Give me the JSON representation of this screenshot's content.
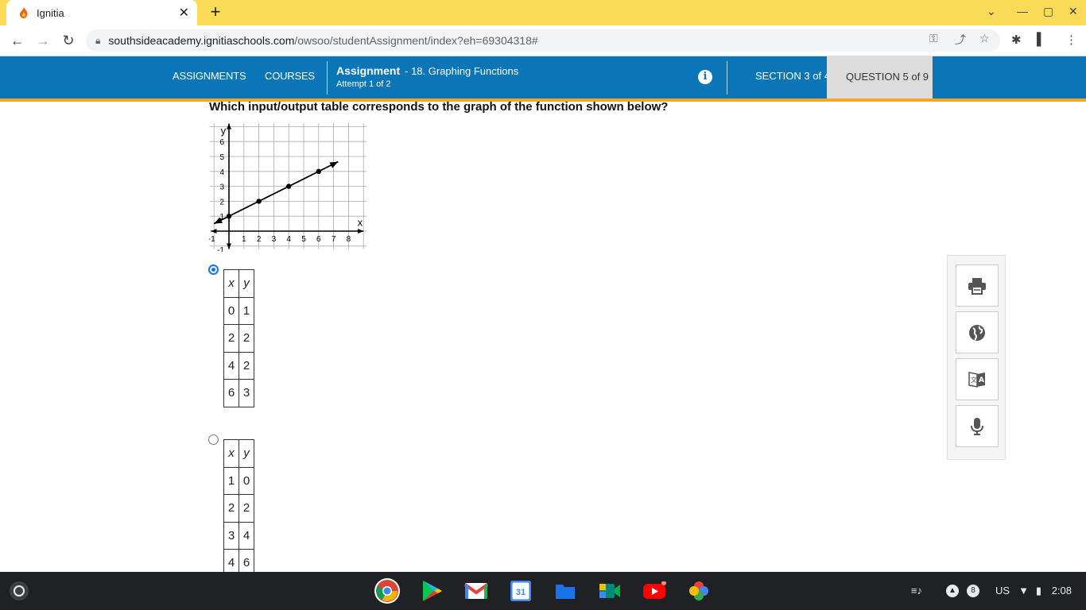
{
  "browser": {
    "tab_title": "Ignitia",
    "url_host": "southsideacademy.ignitiaschools.com",
    "url_path": "/owsoo/studentAssignment/index?eh=69304318#"
  },
  "header": {
    "nav_assignments": "ASSIGNMENTS",
    "nav_courses": "COURSES",
    "assignment_label": "Assignment",
    "assignment_name": "- 18. Graphing Functions",
    "attempt": "Attempt 1 of 2",
    "section": "SECTION 3 of 4",
    "question": "QUESTION 5 of 9"
  },
  "question": {
    "prompt": "Which input/output table corresponds to the graph of the function shown below?"
  },
  "graph": {
    "x_label": "x",
    "y_label": "y",
    "x_ticks": [
      "-1",
      "1",
      "2",
      "3",
      "4",
      "5",
      "6",
      "7",
      "8"
    ],
    "y_ticks": [
      "6",
      "5",
      "4",
      "3",
      "2",
      "1",
      "-1"
    ],
    "points": [
      [
        0,
        1
      ],
      [
        2,
        2
      ],
      [
        4,
        3
      ],
      [
        6,
        4
      ]
    ]
  },
  "options": [
    {
      "selected": true,
      "header": [
        "x",
        "y"
      ],
      "rows": [
        [
          "0",
          "1"
        ],
        [
          "2",
          "2"
        ],
        [
          "4",
          "2"
        ],
        [
          "6",
          "3"
        ]
      ]
    },
    {
      "selected": false,
      "header": [
        "x",
        "y"
      ],
      "rows": [
        [
          "1",
          "0"
        ],
        [
          "2",
          "2"
        ],
        [
          "3",
          "4"
        ],
        [
          "4",
          "6"
        ]
      ]
    }
  ],
  "tools": [
    "print-icon",
    "globe-icon",
    "translate-icon",
    "microphone-icon"
  ],
  "tray": {
    "notifications": "8",
    "keyboard": "US",
    "time": "2:08"
  },
  "colors": {
    "header_blue": "#0a76b7",
    "accent_orange": "#f5a623",
    "chrome_yellow": "#f9db57"
  }
}
